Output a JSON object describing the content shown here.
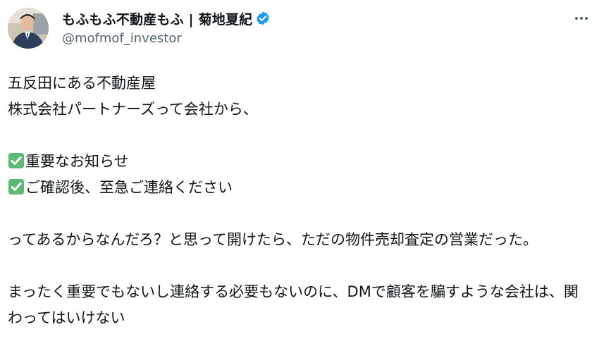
{
  "author": {
    "display_name": "もふもふ不動産もふ | 菊地夏紀",
    "handle": "@mofmof_investor",
    "avatar_icon": "profile-photo",
    "verified_icon": "verified-badge-icon",
    "verified_color": "#1d9bf0"
  },
  "menu": {
    "more_icon": "more-options-icon"
  },
  "tweet": {
    "line1": "五反田にある不動産屋",
    "line2": "株式会社パートナーズって会社から、",
    "check1": "重要なお知らせ",
    "check2": "ご確認後、至急ご連絡ください",
    "para2": "ってあるからなんだろ？と思って開けたら、ただの物件売却査定の営業だった。",
    "para3": "まったく重要でもないし連絡する必要もないのに、DMで顧客を騙すような会社は、関わってはいけない",
    "check_icon_color": "#5bb974"
  }
}
